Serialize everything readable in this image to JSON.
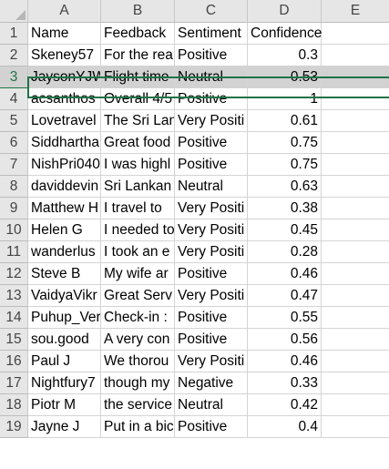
{
  "columns": [
    "A",
    "B",
    "C",
    "D",
    "E"
  ],
  "header_row": {
    "row": "1",
    "cells": [
      "Name",
      "Feedback",
      "Sentiment",
      "Confidence",
      ""
    ]
  },
  "rows": [
    {
      "row": "2",
      "cells": [
        "Skeney57",
        "For the rea",
        "Positive",
        "0.3",
        ""
      ]
    },
    {
      "row": "3",
      "cells": [
        "JaysonYJW",
        "Flight time",
        "Neutral",
        "0.53",
        ""
      ]
    },
    {
      "row": "4",
      "cells": [
        "acsanthos",
        "Overall 4/5",
        "Positive",
        "1",
        ""
      ]
    },
    {
      "row": "5",
      "cells": [
        "Lovetravel",
        "The Sri Lan",
        "Very Positi",
        "0.61",
        ""
      ]
    },
    {
      "row": "6",
      "cells": [
        "Siddhartha",
        "Great food",
        "Positive",
        "0.75",
        ""
      ]
    },
    {
      "row": "7",
      "cells": [
        "NishPri040",
        "I was highl",
        "Positive",
        "0.75",
        ""
      ]
    },
    {
      "row": "8",
      "cells": [
        "daviddevin",
        "Sri Lankan",
        "Neutral",
        "0.63",
        ""
      ]
    },
    {
      "row": "9",
      "cells": [
        "Matthew H",
        "I travel to",
        "Very Positi",
        "0.38",
        ""
      ]
    },
    {
      "row": "10",
      "cells": [
        "Helen G",
        "I needed to",
        "Very Positi",
        "0.45",
        ""
      ]
    },
    {
      "row": "11",
      "cells": [
        "wanderlus",
        "I took an e",
        "Very Positi",
        "0.28",
        ""
      ]
    },
    {
      "row": "12",
      "cells": [
        "Steve B",
        "My wife ar",
        "Positive",
        "0.46",
        ""
      ]
    },
    {
      "row": "13",
      "cells": [
        "VaidyaVikr",
        "Great Serv",
        "Very Positi",
        "0.47",
        ""
      ]
    },
    {
      "row": "14",
      "cells": [
        "Puhup_Ver",
        "Check-in :",
        "Positive",
        "0.55",
        ""
      ]
    },
    {
      "row": "15",
      "cells": [
        "sou.good",
        "A very con",
        "Positive",
        "0.56",
        ""
      ]
    },
    {
      "row": "16",
      "cells": [
        "Paul J",
        "We thorou",
        "Very Positi",
        "0.46",
        ""
      ]
    },
    {
      "row": "17",
      "cells": [
        "Nightfury7",
        "though my",
        "Negative",
        "0.33",
        ""
      ]
    },
    {
      "row": "18",
      "cells": [
        "Piotr M",
        "the service",
        "Neutral",
        "0.42",
        ""
      ]
    },
    {
      "row": "19",
      "cells": [
        "Jayne J",
        "Put in a bic",
        "Positive",
        "0.4",
        ""
      ]
    }
  ],
  "selected_row": "3",
  "colors": {
    "selection": "#217346",
    "header_bg": "#e6e6e6",
    "selected_bg": "#d2d2d2"
  }
}
